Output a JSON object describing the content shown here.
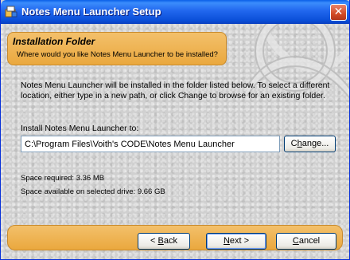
{
  "window": {
    "title": "Notes Menu Launcher Setup",
    "icon": "setup-installer-icon",
    "close_icon": "close-icon"
  },
  "header": {
    "title": "Installation Folder",
    "subtitle": "Where would you like Notes Menu Launcher to be installed?"
  },
  "body": {
    "description": "Notes Menu Launcher will be installed in the folder listed below. To select a different location, either type in a new path, or click Change to browse for an existing folder.",
    "path_label": "Install Notes Menu Launcher to:",
    "path_value": "C:\\Program Files\\Voith's CODE\\Notes Menu Launcher",
    "change_button": {
      "pre": "C",
      "accel": "h",
      "post": "ange..."
    },
    "space_required": "Space required: 3.36 MB",
    "space_available": "Space available on selected drive: 9.66 GB"
  },
  "footer": {
    "back_button": {
      "pre": "< ",
      "accel": "B",
      "post": "ack"
    },
    "next_button": {
      "pre": "",
      "accel": "N",
      "post": "ext >"
    },
    "cancel_button": {
      "pre": "",
      "accel": "C",
      "post": "ancel"
    }
  },
  "colors": {
    "titlebar": "#2167ee",
    "accent_band": "#eaa83e",
    "close_button": "#d24a25"
  }
}
